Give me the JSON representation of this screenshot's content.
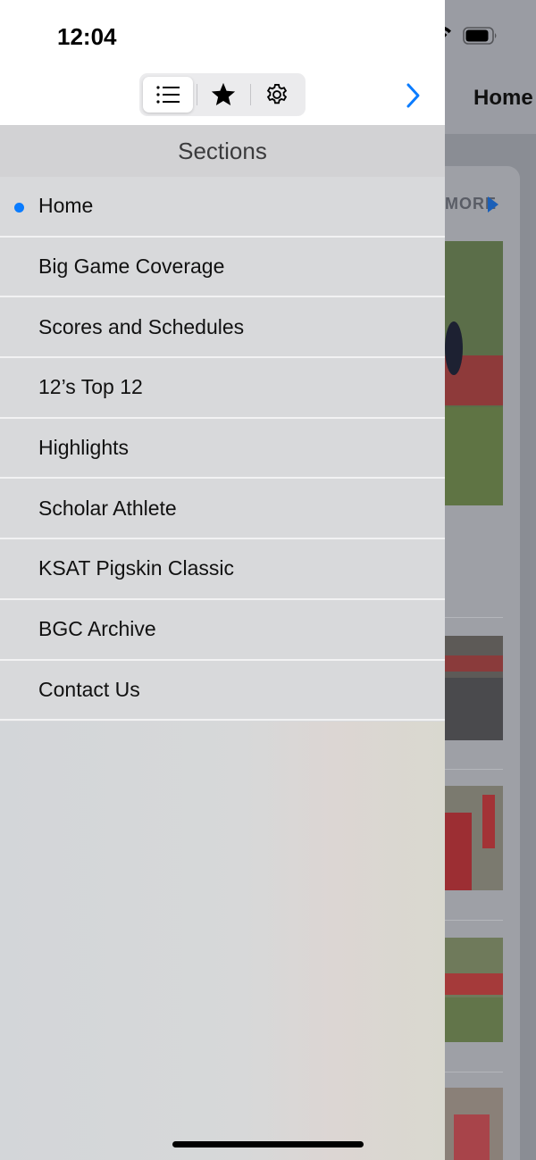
{
  "status_bar": {
    "time": "12:04"
  },
  "toolbar": {
    "tabs": [
      {
        "name": "sections",
        "icon": "list-icon",
        "active": true
      },
      {
        "name": "favorites",
        "icon": "star-icon",
        "active": false
      },
      {
        "name": "settings",
        "icon": "gear-icon",
        "active": false
      }
    ],
    "forward_icon": "chevron-right-icon"
  },
  "drawer": {
    "title": "Sections",
    "items": [
      {
        "label": "Home",
        "selected": true
      },
      {
        "label": "Big Game Coverage",
        "selected": false
      },
      {
        "label": "Scores and Schedules",
        "selected": false
      },
      {
        "label": "12’s Top 12",
        "selected": false
      },
      {
        "label": "Highlights",
        "selected": false
      },
      {
        "label": "Scholar Athlete",
        "selected": false
      },
      {
        "label": "KSAT Pigskin Classic",
        "selected": false
      },
      {
        "label": "BGC Archive",
        "selected": false
      },
      {
        "label": "Contact Us",
        "selected": false
      }
    ]
  },
  "background_app": {
    "title": "Home",
    "more_label": "MORE"
  },
  "colors": {
    "accent": "#0a7cff",
    "selected_dot": "#0a7cff"
  }
}
